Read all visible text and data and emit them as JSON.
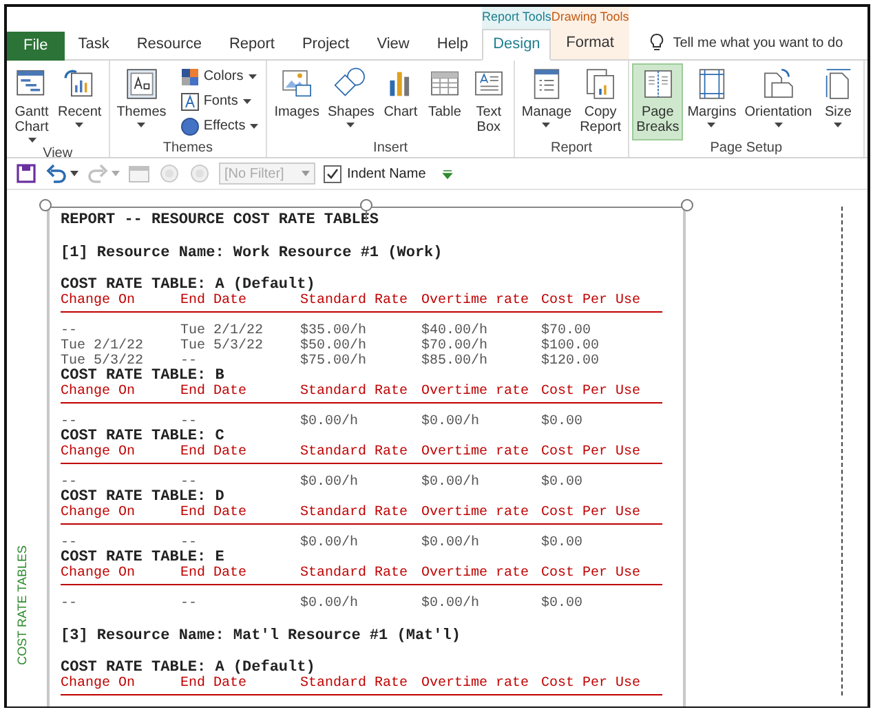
{
  "tabs": [
    {
      "label": "File",
      "kind": "file",
      "selected": false
    },
    {
      "label": "Task",
      "kind": "tab",
      "selected": false
    },
    {
      "label": "Resource",
      "kind": "tab",
      "selected": false
    },
    {
      "label": "Report",
      "kind": "tab",
      "selected": false
    },
    {
      "label": "Project",
      "kind": "tab",
      "selected": false
    },
    {
      "label": "View",
      "kind": "tab",
      "selected": false
    },
    {
      "label": "Help",
      "kind": "tab",
      "selected": false
    },
    {
      "label": "Design",
      "kind": "contextual",
      "selected": true,
      "context": "Report Tools",
      "color": "#1f7f8f"
    },
    {
      "label": "Format",
      "kind": "contextual",
      "selected": false,
      "context": "Drawing Tools",
      "color": "#c55a11"
    }
  ],
  "tell_me": {
    "placeholder": "Tell me what you want to do"
  },
  "ribbon_groups": [
    {
      "label": "View",
      "buttons": [
        {
          "label": "Gantt\nChart",
          "kind": "large",
          "dropdown": true,
          "selected": false
        },
        {
          "label": "Recent",
          "kind": "large",
          "dropdown": true,
          "selected": false
        }
      ]
    },
    {
      "label": "Themes",
      "buttons": [
        {
          "label": "Themes",
          "kind": "large",
          "dropdown": true,
          "selected": false
        },
        {
          "label": "Colors",
          "kind": "small",
          "dropdown": true
        },
        {
          "label": "Fonts",
          "kind": "small",
          "dropdown": true
        },
        {
          "label": "Effects",
          "kind": "small",
          "dropdown": true
        }
      ]
    },
    {
      "label": "Insert",
      "buttons": [
        {
          "label": "Images",
          "kind": "large",
          "dropdown": false,
          "selected": false
        },
        {
          "label": "Shapes",
          "kind": "large",
          "dropdown": true,
          "selected": false
        },
        {
          "label": "Chart",
          "kind": "large",
          "dropdown": false,
          "selected": false
        },
        {
          "label": "Table",
          "kind": "large",
          "dropdown": false,
          "selected": false
        },
        {
          "label": "Text\nBox",
          "kind": "large",
          "dropdown": false,
          "selected": false
        }
      ]
    },
    {
      "label": "Report",
      "buttons": [
        {
          "label": "Manage",
          "kind": "large",
          "dropdown": true,
          "selected": false
        },
        {
          "label": "Copy\nReport",
          "kind": "large",
          "dropdown": false,
          "selected": false
        }
      ]
    },
    {
      "label": "Page Setup",
      "buttons": [
        {
          "label": "Page\nBreaks",
          "kind": "large",
          "dropdown": false,
          "selected": true
        },
        {
          "label": "Margins",
          "kind": "large",
          "dropdown": true,
          "selected": false
        },
        {
          "label": "Orientation",
          "kind": "large",
          "dropdown": true,
          "selected": false
        },
        {
          "label": "Size",
          "kind": "large",
          "dropdown": true,
          "selected": false
        }
      ]
    }
  ],
  "quick_access": {
    "buttons": [
      {
        "kind": "save",
        "disabled": false,
        "dropdown": false
      },
      {
        "kind": "undo",
        "disabled": false,
        "dropdown": true
      },
      {
        "kind": "redo",
        "disabled": true,
        "dropdown": true
      },
      {
        "kind": "window",
        "disabled": true,
        "dropdown": false
      },
      {
        "kind": "circle",
        "disabled": true,
        "dropdown": false
      },
      {
        "kind": "circle",
        "disabled": true,
        "dropdown": false
      }
    ],
    "filter": {
      "value": "[No Filter]",
      "disabled": true
    },
    "indent_name": {
      "label": "Indent Name",
      "checked": true
    }
  },
  "side_label": "COST RATE TABLES",
  "report": {
    "title": "REPORT -- RESOURCE COST RATE TABLES",
    "resources": [
      {
        "heading": "[1] Resource Name: Work Resource #1 (Work)",
        "tables": [
          {
            "title": "COST RATE TABLE: A (Default)",
            "columns": [
              "Change On",
              "End Date",
              "Standard Rate",
              "Overtime rate",
              "Cost Per Use"
            ],
            "rows": [
              [
                "--",
                "Tue 2/1/22",
                "$35.00/h",
                "$40.00/h",
                "$70.00"
              ],
              [
                "Tue 2/1/22",
                "Tue 5/3/22",
                "$50.00/h",
                "$70.00/h",
                "$100.00"
              ],
              [
                "Tue 5/3/22",
                "--",
                "$75.00/h",
                "$85.00/h",
                "$120.00"
              ]
            ]
          },
          {
            "title": "COST RATE TABLE: B",
            "columns": [
              "Change On",
              "End Date",
              "Standard Rate",
              "Overtime rate",
              "Cost Per Use"
            ],
            "rows": [
              [
                "--",
                "--",
                "$0.00/h",
                "$0.00/h",
                "$0.00"
              ]
            ]
          },
          {
            "title": "COST RATE TABLE: C",
            "columns": [
              "Change On",
              "End Date",
              "Standard Rate",
              "Overtime rate",
              "Cost Per Use"
            ],
            "rows": [
              [
                "--",
                "--",
                "$0.00/h",
                "$0.00/h",
                "$0.00"
              ]
            ]
          },
          {
            "title": "COST RATE TABLE: D",
            "columns": [
              "Change On",
              "End Date",
              "Standard Rate",
              "Overtime rate",
              "Cost Per Use"
            ],
            "rows": [
              [
                "--",
                "--",
                "$0.00/h",
                "$0.00/h",
                "$0.00"
              ]
            ]
          },
          {
            "title": "COST RATE TABLE: E",
            "columns": [
              "Change On",
              "End Date",
              "Standard Rate",
              "Overtime rate",
              "Cost Per Use"
            ],
            "rows": [
              [
                "--",
                "--",
                "$0.00/h",
                "$0.00/h",
                "$0.00"
              ]
            ]
          }
        ]
      },
      {
        "heading": "[3] Resource Name: Mat'l Resource #1 (Mat'l)",
        "tables": [
          {
            "title": "COST RATE TABLE: A (Default)",
            "columns": [
              "Change On",
              "End Date",
              "Standard Rate",
              "Overtime rate",
              "Cost Per Use"
            ]
          }
        ]
      }
    ]
  }
}
